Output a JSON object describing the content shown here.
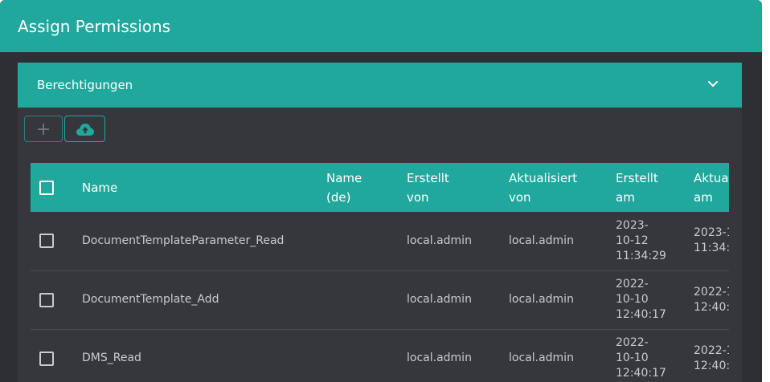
{
  "dialog": {
    "title": "Assign Permissions"
  },
  "panel": {
    "title": "Berechtigungen",
    "expanded": true
  },
  "toolbar": {
    "add_icon": "plus-icon",
    "upload_icon": "cloud-upload-icon"
  },
  "table": {
    "headers": {
      "name": "Name",
      "name_de_1": "Name",
      "name_de_2": "(de)",
      "created_by_1": "Erstellt",
      "created_by_2": "von",
      "updated_by_1": "Aktualisiert",
      "updated_by_2": "von",
      "created_at_1": "Erstellt",
      "created_at_2": "am",
      "updated_at_1": "Aktua",
      "updated_at_2": "am"
    },
    "rows": [
      {
        "name": "DocumentTemplateParameter_Read",
        "name_de": "",
        "created_by": "local.admin",
        "updated_by": "local.admin",
        "created_at_1": "2023-",
        "created_at_2": "10-12",
        "created_at_3": "11:34:29",
        "updated_at_1": "2023-1",
        "updated_at_2": "11:34:2"
      },
      {
        "name": "DocumentTemplate_Add",
        "name_de": "",
        "created_by": "local.admin",
        "updated_by": "local.admin",
        "created_at_1": "2022-",
        "created_at_2": "10-10",
        "created_at_3": "12:40:17",
        "updated_at_1": "2022-1",
        "updated_at_2": "12:40:1"
      },
      {
        "name": "DMS_Read",
        "name_de": "",
        "created_by": "local.admin",
        "updated_by": "local.admin",
        "created_at_1": "2022-",
        "created_at_2": "10-10",
        "created_at_3": "12:40:17",
        "updated_at_1": "2022-1",
        "updated_at_2": "12:40:1"
      }
    ]
  },
  "colors": {
    "accent": "#21a89d",
    "background": "#2e2f33",
    "panel_body": "#36373d",
    "text_muted": "#c9cacf"
  }
}
